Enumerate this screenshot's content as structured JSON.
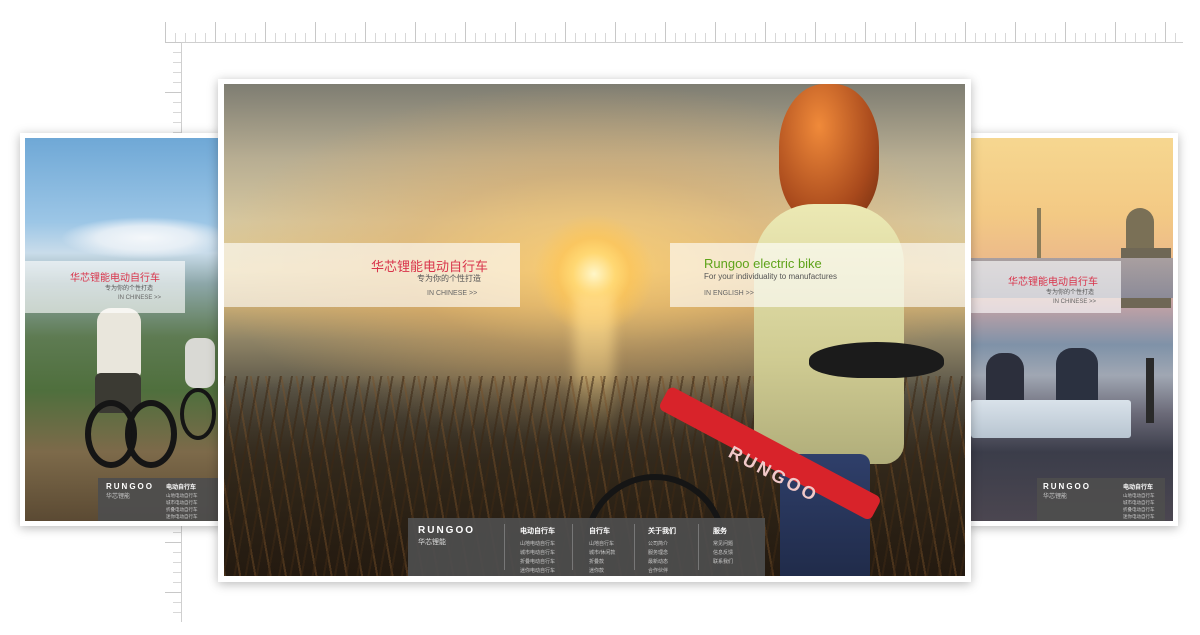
{
  "page_cn": {
    "title": "华芯锂能电动自行车",
    "subtitle": "专为你的个性打造",
    "link": "IN CHINESE >>"
  },
  "page_en": {
    "title": "Rungoo electric bike",
    "subtitle": "For your individuality to manufactures",
    "link": "IN ENGLISH >>"
  },
  "brand": {
    "logo": "RUNGOO",
    "logo_cn": "华芯锂能",
    "bike_decal": "RUNGOO"
  },
  "footer": {
    "columns": [
      {
        "heading": "电动自行车",
        "items": [
          "山地电动自行车",
          "城市电动自行车",
          "折叠电动自行车",
          "迷你电动自行车"
        ]
      },
      {
        "heading": "自行车",
        "items": [
          "山地自行车",
          "城市/休闲款",
          "折叠款",
          "迷你款"
        ]
      },
      {
        "heading": "关于我们",
        "items": [
          "公司简介",
          "服务理念",
          "最新动态",
          "合作伙伴"
        ]
      },
      {
        "heading": "服务",
        "items": [
          "常见问题",
          "信息反馈",
          "联系我们"
        ]
      }
    ]
  },
  "colors": {
    "cn_accent": "#d9344b",
    "en_accent": "#5ea31a",
    "footer_bg": "#4e4e4e"
  }
}
